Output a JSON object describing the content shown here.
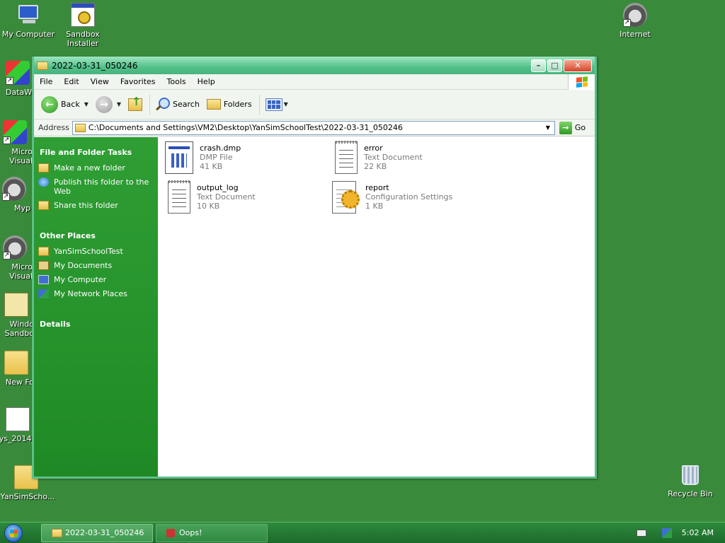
{
  "desktop": {
    "icons": [
      {
        "label": "My Computer",
        "icon": "computer-icon"
      },
      {
        "label": "Sandbox\nInstaller",
        "icon": "installer-icon"
      },
      {
        "label": "Internet",
        "icon": "internet-icon"
      },
      {
        "label": "DataWi",
        "icon": "datawi-icon"
      },
      {
        "label": "Micro\nVisual",
        "icon": "visual-studio-icon"
      },
      {
        "label": "Myp",
        "icon": "myp-icon"
      },
      {
        "label": "Micro\nVisual",
        "icon": "visual-icon"
      },
      {
        "label": "Windo\nSandbo",
        "icon": "sandbox-icon"
      },
      {
        "label": "New Fo",
        "icon": "folder-icon"
      },
      {
        "label": "ys_2014_",
        "icon": "file-icon"
      },
      {
        "label": "YanSimScho...",
        "icon": "folder-icon"
      },
      {
        "label": "Recycle Bin",
        "icon": "recycle-bin-icon"
      }
    ]
  },
  "window": {
    "title": "2022-03-31_050246",
    "controls": {
      "minimize": "–",
      "maximize": "□",
      "close": "✕"
    },
    "menu": [
      "File",
      "Edit",
      "View",
      "Favorites",
      "Tools",
      "Help"
    ],
    "toolbar": {
      "back": "Back",
      "search": "Search",
      "folders": "Folders"
    },
    "address": {
      "label": "Address",
      "value": "C:\\Documents and Settings\\VM2\\Desktop\\YanSimSchoolTest\\2022-03-31_050246",
      "go": "Go"
    },
    "taskpane": {
      "file_tasks": {
        "heading": "File and Folder Tasks",
        "items": [
          "Make a new folder",
          "Publish this folder to the Web",
          "Share this folder"
        ]
      },
      "other_places": {
        "heading": "Other Places",
        "items": [
          "YanSimSchoolTest",
          "My Documents",
          "My Computer",
          "My Network Places"
        ]
      },
      "details": {
        "heading": "Details"
      }
    },
    "files": [
      {
        "name": "crash.dmp",
        "type": "DMP File",
        "size": "41 KB",
        "icon": "dmp-file-icon"
      },
      {
        "name": "error",
        "type": "Text Document",
        "size": "22 KB",
        "icon": "text-document-icon"
      },
      {
        "name": "output_log",
        "type": "Text Document",
        "size": "10 KB",
        "icon": "text-document-icon"
      },
      {
        "name": "report",
        "type": "Configuration Settings",
        "size": "1 KB",
        "icon": "config-settings-icon"
      }
    ]
  },
  "taskbar": {
    "tasks": [
      {
        "label": "2022-03-31_050246",
        "state": "active"
      },
      {
        "label": "Oops!",
        "state": "inactive"
      }
    ],
    "clock": "5:02 AM"
  },
  "colors": {
    "desktop": "#3a8a3c",
    "taskpane": "#2f9e34",
    "titlebar": "#53c08a"
  }
}
